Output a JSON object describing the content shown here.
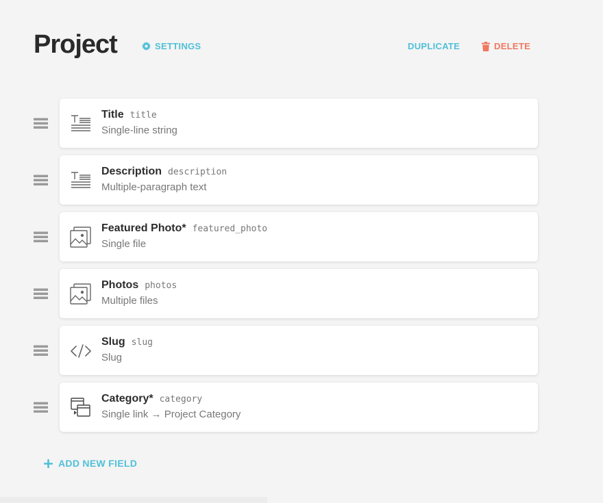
{
  "header": {
    "title": "Project",
    "settings_label": "SETTINGS",
    "duplicate_label": "DUPLICATE",
    "delete_label": "DELETE"
  },
  "fields": [
    {
      "name": "Title",
      "key": "title",
      "type": "Single-line string",
      "icon": "text-field-icon"
    },
    {
      "name": "Description",
      "key": "description",
      "type": "Multiple-paragraph text",
      "icon": "text-field-icon"
    },
    {
      "name": "Featured Photo*",
      "key": "featured_photo",
      "type": "Single file",
      "icon": "image-field-icon"
    },
    {
      "name": "Photos",
      "key": "photos",
      "type": "Multiple files",
      "icon": "image-field-icon"
    },
    {
      "name": "Slug",
      "key": "slug",
      "type": "Slug",
      "icon": "code-icon"
    },
    {
      "name": "Category*",
      "key": "category",
      "type": "Single link → Project Category",
      "icon": "link-field-icon"
    }
  ],
  "add_field_label": "ADD NEW FIELD",
  "colors": {
    "accent": "#4fc0d8",
    "danger": "#f07860",
    "background": "#f4f4f4",
    "card": "#ffffff"
  }
}
